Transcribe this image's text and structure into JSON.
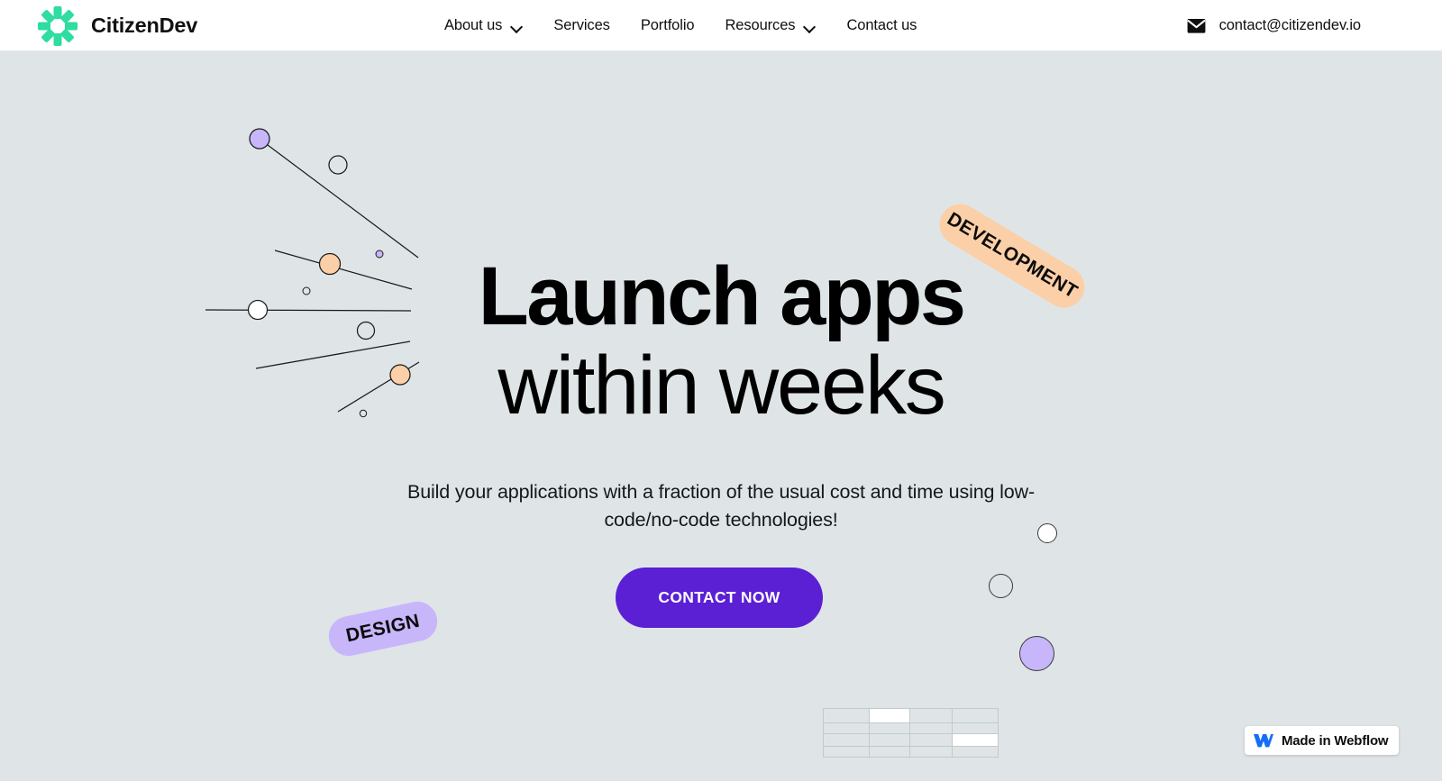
{
  "colors": {
    "page_background": "#dfe5e7",
    "header_background": "#ffffff",
    "brand_green": "#2edd9f",
    "cta_purple": "#5b1fd4",
    "badge_development": "#fbd0a8",
    "badge_design": "#c8b6fb",
    "webflow_blue": "#146ef5",
    "text": "#000000"
  },
  "header": {
    "brand": {
      "name": "CitizenDev",
      "logo_icon": "starburst-sun-icon"
    },
    "nav": [
      {
        "label": "About us",
        "has_dropdown": true,
        "icon": "chevron-down-icon"
      },
      {
        "label": "Services",
        "has_dropdown": false
      },
      {
        "label": "Portfolio",
        "has_dropdown": false
      },
      {
        "label": "Resources",
        "has_dropdown": true,
        "icon": "chevron-down-icon"
      },
      {
        "label": "Contact us",
        "has_dropdown": false
      }
    ],
    "contact": {
      "icon": "envelope-icon",
      "email": "contact@citizendev.io"
    }
  },
  "hero": {
    "headline_line1": "Launch apps",
    "headline_line2": "within weeks",
    "subtitle": "Build your applications with a fraction of the usual cost and time using low-code/no-code technologies!",
    "cta_label": "CONTACT NOW",
    "badges": [
      {
        "label": "DEVELOPMENT",
        "color": "#fbd0a8",
        "rotation": 31
      },
      {
        "label": "DESIGN",
        "color": "#c8b6fb",
        "rotation": -12
      }
    ],
    "decoration": {
      "left_graphic": "abstract-lines-and-dots",
      "right_dots": [
        {
          "name": "white-dot",
          "fill": "#ffffff",
          "size": 22
        },
        {
          "name": "outline-dot",
          "fill": "none",
          "size": 27
        },
        {
          "name": "purple-dot",
          "fill": "#c8b6fb",
          "size": 39
        }
      ],
      "grid": {
        "columns": 4,
        "rows": 4,
        "highlighted_cells": [
          [
            0,
            1
          ],
          [
            2,
            3
          ]
        ]
      }
    }
  },
  "footer_badge": {
    "label": "Made in Webflow",
    "icon": "webflow-logo-icon"
  }
}
